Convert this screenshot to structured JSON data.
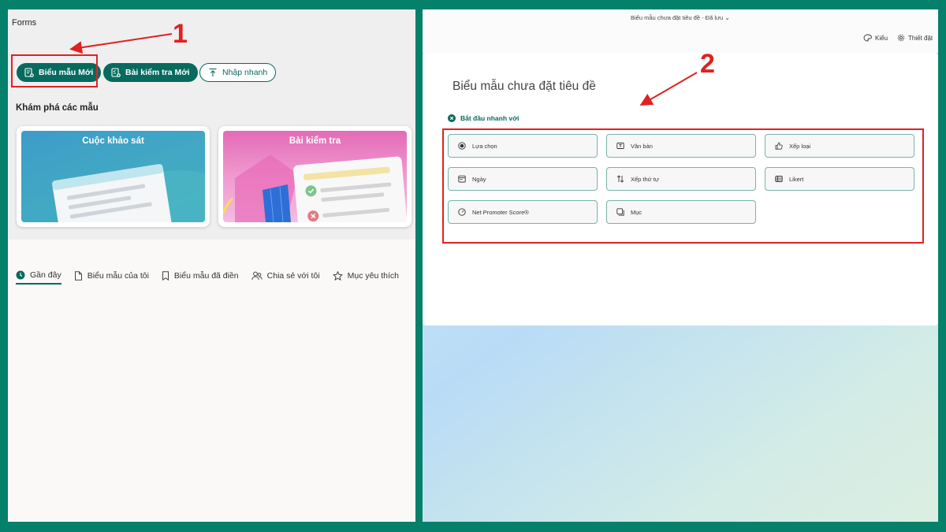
{
  "left": {
    "app_title": "Forms",
    "buttons": {
      "new_form": "Biểu mẫu Mới",
      "new_quiz": "Bài kiểm tra Mới",
      "quick_import": "Nhập nhanh"
    },
    "explore_heading": "Khám phá các mẫu",
    "templates": [
      {
        "label": "Cuộc khảo sát"
      },
      {
        "label": "Bài kiểm tra"
      }
    ],
    "tabs": [
      {
        "label": "Gần đây",
        "icon": "clock-icon",
        "active": true
      },
      {
        "label": "Biểu mẫu của tôi",
        "icon": "document-icon"
      },
      {
        "label": "Biểu mẫu đã điền",
        "icon": "bookmark-icon"
      },
      {
        "label": "Chia sẻ với tôi",
        "icon": "people-icon"
      },
      {
        "label": "Mục yêu thích",
        "icon": "star-icon"
      }
    ]
  },
  "annotations": {
    "step1": "1",
    "step2": "2",
    "color": "#e02121"
  },
  "right": {
    "doc_title": "Biểu mẫu chưa đặt tiêu đề  -  Đã lưu",
    "header_actions": {
      "style": "Kiểu",
      "settings": "Thiết đặt"
    },
    "form_title": "Biểu mẫu chưa đặt tiêu đề",
    "quick_start": "Bắt đầu nhanh với",
    "question_types": [
      {
        "label": "Lựa chọn",
        "icon": "radio-icon"
      },
      {
        "label": "Văn bản",
        "icon": "text-icon"
      },
      {
        "label": "Xếp loại",
        "icon": "thumbs-up-icon"
      },
      {
        "label": "Ngày",
        "icon": "calendar-icon"
      },
      {
        "label": "Xếp thứ tự",
        "icon": "sort-icon"
      },
      {
        "label": "Likert",
        "icon": "likert-icon"
      },
      {
        "label": "Net Promoter Score®",
        "icon": "gauge-icon"
      },
      {
        "label": "Mục",
        "icon": "section-icon"
      }
    ]
  },
  "colors": {
    "frame": "#05806b",
    "accent": "#086a5f"
  }
}
